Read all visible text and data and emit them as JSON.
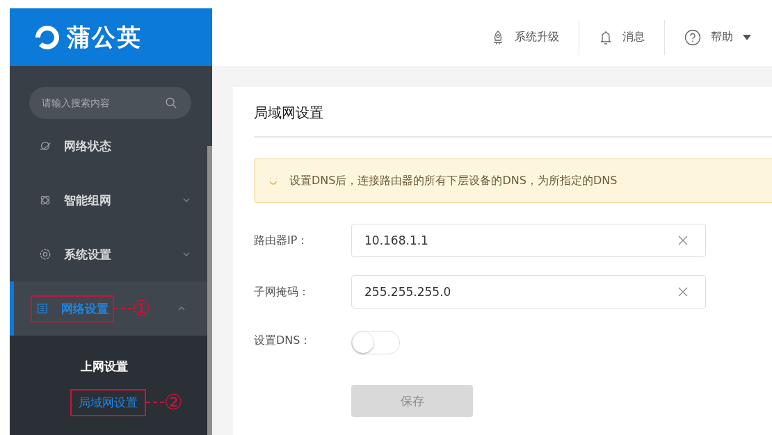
{
  "logo": {
    "text": "蒲公英"
  },
  "header": {
    "actions": [
      {
        "label": "系统升级"
      },
      {
        "label": "消息"
      },
      {
        "label": "帮助",
        "dropdown": true
      }
    ]
  },
  "sidebar": {
    "search": {
      "placeholder": "请输入搜索内容"
    },
    "items": [
      {
        "label": "网络状态",
        "selected": false
      },
      {
        "label": "智能组网",
        "selected": false,
        "expanded": false
      },
      {
        "label": "系统设置",
        "selected": false,
        "expanded": false
      },
      {
        "label": "网络设置",
        "selected": true,
        "expanded": true,
        "annotation": "①",
        "children": [
          {
            "label": "上网设置",
            "selected": false
          },
          {
            "label": "局域网设置",
            "selected": true,
            "annotation": "②"
          }
        ]
      }
    ]
  },
  "panel": {
    "title": "局域网设置",
    "notice": "设置DNS后，连接路由器的所有下层设备的DNS，为所指定的DNS",
    "fields": [
      {
        "kind": "text",
        "label": "路由器IP：",
        "value": "10.168.1.1"
      },
      {
        "kind": "text",
        "label": "子网掩码：",
        "value": "255.255.255.0"
      },
      {
        "kind": "switch",
        "label": "设置DNS：",
        "on": false
      }
    ],
    "button": {
      "label": "保存",
      "disabled": true
    }
  }
}
